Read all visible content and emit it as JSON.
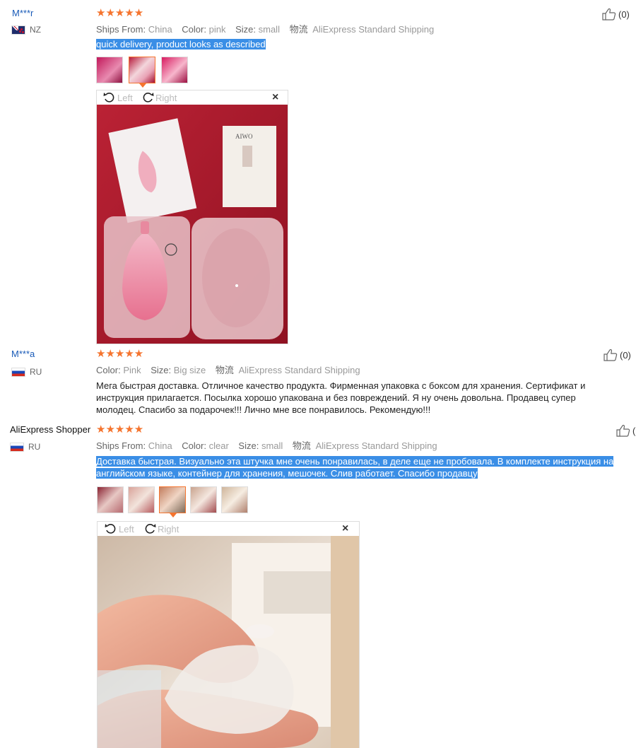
{
  "reviews": [
    {
      "user": "M***r",
      "country": "NZ",
      "stars": "★★★★★",
      "meta": {
        "ships_from_label": "Ships From:",
        "ships_from": "China",
        "color_label": "Color:",
        "color": "pink",
        "size_label": "Size:",
        "size": "small",
        "shipping_icon": "物流",
        "shipping": "AliExpress Standard Shipping"
      },
      "text": "quick delivery, product looks as described",
      "likes": "(0)",
      "viewer": {
        "left": "Left",
        "right": "Right",
        "close": "×"
      }
    },
    {
      "user": "M***a",
      "country": "RU",
      "stars": "★★★★★",
      "meta": {
        "color_label": "Color:",
        "color": "Pink",
        "size_label": "Size:",
        "size": "Big size",
        "shipping_icon": "物流",
        "shipping": "AliExpress Standard Shipping"
      },
      "text": "Мега быстрая доставка. Отличное качество продукта. Фирменная упаковка с боксом для хранения. Сертификат и инструкция прилагается. Посылка хорошо упакована и без повреждений. Я ну очень довольна. Продавец супер молодец. Спасибо за подарочек!!! Лично мне все понравилось. Рекомендую!!!",
      "likes": "(0)"
    },
    {
      "user": "AliExpress Shopper",
      "country": "RU",
      "stars": "★★★★★",
      "meta": {
        "ships_from_label": "Ships From:",
        "ships_from": "China",
        "color_label": "Color:",
        "color": "clear",
        "size_label": "Size:",
        "size": "small",
        "shipping_icon": "物流",
        "shipping": "AliExpress Standard Shipping"
      },
      "text": "Доставка быстрая. Визуально эта штучка мне очень понравилась, в деле еще не пробовала. В комплекте инструкция на английском языке, контейнер для хранения, мешочек. Слив работает. Спасибо продавцу",
      "likes": "(",
      "viewer": {
        "left": "Left",
        "right": "Right",
        "close": "×"
      }
    }
  ],
  "colors": {
    "star": "#f5742e",
    "username": "#1a5bb8",
    "highlight": "#3a8ee6"
  }
}
